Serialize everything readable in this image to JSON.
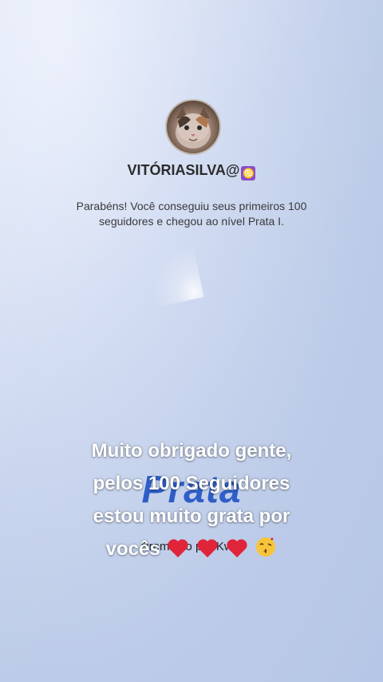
{
  "profile": {
    "username": "VITÓRIASILVA@",
    "zodiac_icon": "cancer-zodiac-icon",
    "zodiac_symbol": "♋"
  },
  "achievement": {
    "message": "Parabéns! Você conseguiu seus primeiros 100 seguidores e chegou ao nível Prata I.",
    "level_word": "Prata",
    "awarded_by": "Premiado por Kwai"
  },
  "caption": {
    "line1": "Muito obrigado gente,",
    "line2": "pelos 100 Seguidores",
    "line3": "estou muito grata por",
    "line4": "vocês",
    "emojis": [
      "heart-icon",
      "heart-icon",
      "heart-icon",
      "kissing-face-icon"
    ]
  },
  "colors": {
    "level_word": "#2f5ec7",
    "heart": "#e0243a",
    "zodiac_badge": "#8b4bc9"
  }
}
